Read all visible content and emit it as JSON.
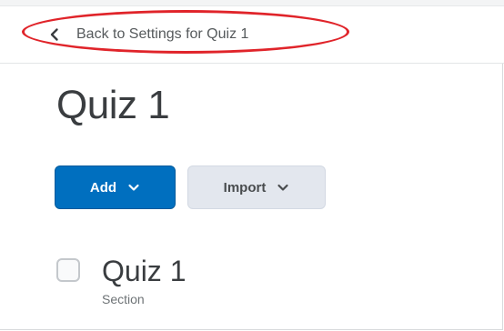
{
  "nav": {
    "back_label": "Back to Settings for Quiz 1",
    "back_icon": "chevron-left-icon"
  },
  "page": {
    "title": "Quiz 1"
  },
  "toolbar": {
    "add_label": "Add",
    "add_icon": "chevron-down-icon",
    "import_label": "Import",
    "import_icon": "chevron-down-icon"
  },
  "items": [
    {
      "title": "Quiz 1",
      "type": "Section",
      "checked": false
    }
  ],
  "colors": {
    "primary_button": "#006fbf",
    "secondary_button": "#e3e7ee",
    "annotation_circle": "#e0242a",
    "text": "#494c4e"
  }
}
